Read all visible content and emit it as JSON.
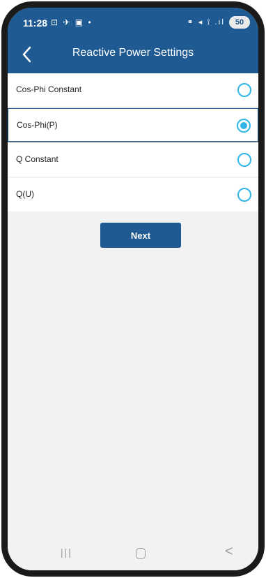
{
  "status_bar": {
    "time": "11:28",
    "left_icons": "⊡ ✈ ▣ •",
    "right_icons": "⚭ ◂ ⟟ .ıl",
    "battery": "50"
  },
  "header": {
    "title": "Reactive Power Settings",
    "back_icon": "chevron-left-icon"
  },
  "options": [
    {
      "label": "Cos-Phi Constant",
      "selected": false
    },
    {
      "label": "Cos-Phi(P)",
      "selected": true
    },
    {
      "label": "Q Constant",
      "selected": false
    },
    {
      "label": "Q(U)",
      "selected": false
    }
  ],
  "next_button": {
    "label": "Next"
  },
  "nav_bar": {
    "recent": "|||",
    "back": "<"
  },
  "colors": {
    "primary": "#1f5a92",
    "radio": "#2fb5e8",
    "background": "#f2f2f2"
  }
}
